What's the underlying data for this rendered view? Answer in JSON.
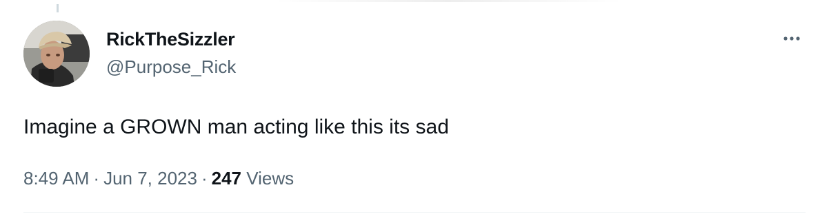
{
  "tweet": {
    "display_name": "RickTheSizzler",
    "handle": "@Purpose_Rick",
    "text": "Imagine a GROWN man acting like this its sad",
    "time": "8:49 AM",
    "separator": "·",
    "date": "Jun 7, 2023",
    "view_count": "247",
    "views_label": "Views",
    "more_icon": "more-horizontal-icon",
    "avatar": "user-avatar"
  },
  "colors": {
    "text_primary": "#0f1419",
    "text_secondary": "#536471",
    "divider": "#eff3f4"
  }
}
